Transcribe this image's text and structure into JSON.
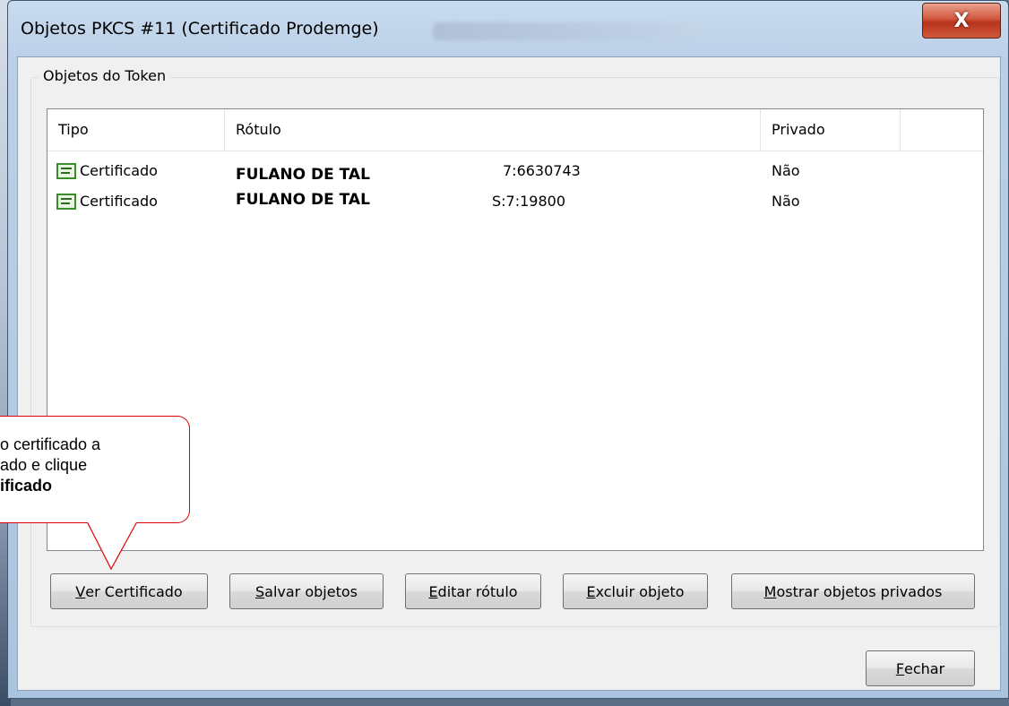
{
  "window": {
    "title": "Objetos PKCS #11 (Certificado Prodemge)",
    "close_label": "X"
  },
  "group": {
    "legend": "Objetos do Token"
  },
  "table": {
    "columns": [
      "Tipo",
      "Rótulo",
      "Privado"
    ],
    "rows": [
      {
        "type": "Certificado",
        "label_name": "FULANO DE TAL",
        "label_suffix": "7:6630743",
        "private": "Não"
      },
      {
        "type": "Certificado",
        "label_name": "FULANO DE TAL",
        "label_suffix": "S:7:19800",
        "private": "Não"
      }
    ]
  },
  "buttons": {
    "view_accel": "V",
    "view_rest": "er Certificado",
    "save_accel": "S",
    "save_rest": "alvar objetos",
    "edit_accel": "E",
    "edit_rest": "ditar rótulo",
    "delete_accel": "E",
    "delete_rest": "xcluir objeto",
    "show_accel": "M",
    "show_rest": "ostrar objetos privados",
    "close_accel": "F",
    "close_rest": "echar"
  },
  "callout": {
    "line1": "o certificado a",
    "line2": "ado e clique",
    "line3": "ificado"
  }
}
